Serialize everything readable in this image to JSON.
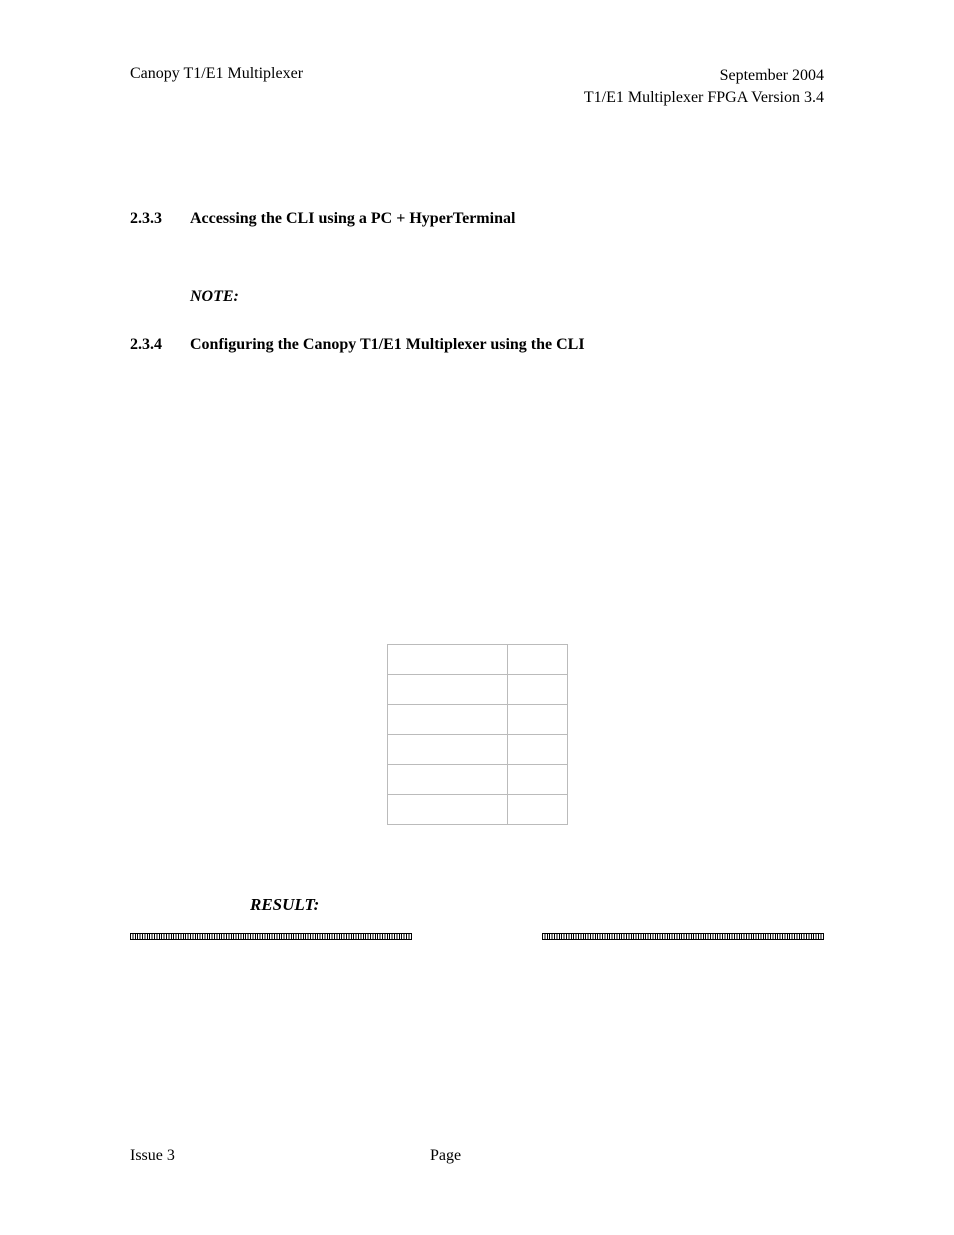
{
  "header": {
    "left": "Canopy T1/E1 Multiplexer",
    "right_line1": "September 2004",
    "right_line2": "T1/E1 Multiplexer FPGA Version 3.4"
  },
  "sections": {
    "s233": {
      "num": "2.3.3",
      "title": "Accessing the CLI using a PC + HyperTerminal"
    },
    "s234": {
      "num": "2.3.4",
      "title": "Configuring the Canopy T1/E1 Multiplexer using the CLI"
    }
  },
  "note_label": "NOTE:",
  "result_label": "RESULT:",
  "table": {
    "rows": [
      {
        "c1": "",
        "c2": ""
      },
      {
        "c1": "",
        "c2": ""
      },
      {
        "c1": "",
        "c2": ""
      },
      {
        "c1": "",
        "c2": ""
      },
      {
        "c1": "",
        "c2": ""
      },
      {
        "c1": "",
        "c2": ""
      }
    ]
  },
  "footer": {
    "left": "Issue 3",
    "center": "Page"
  }
}
